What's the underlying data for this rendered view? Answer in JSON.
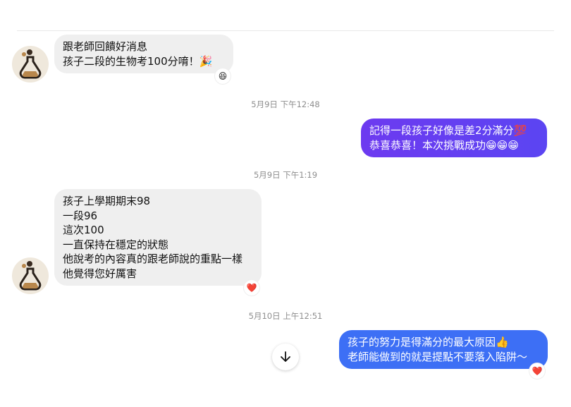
{
  "messages": {
    "m1": {
      "lines": "跟老師回饋好消息\n孩子二段的生物考100分唷！🎉",
      "reaction": "😆"
    },
    "ts1": "5月9日 下午12:48",
    "m2": {
      "lines": "記得一段孩子好像是差2分滿分💯\n恭喜恭喜！本次挑戰成功😁😁😁"
    },
    "ts2": "5月9日 下午1:19",
    "m3": {
      "lines": "孩子上學期期末98\n一段96\n這次100\n一直保持在穩定的狀態\n他說考的內容真的跟老師說的重點一樣\n他覺得您好厲害",
      "reaction": "❤️"
    },
    "ts3": "5月10日 上午12:51",
    "m4": {
      "lines": "孩子的努力是得滿分的最大原因👍\n老師能做到的就是提點不要落入陷阱～",
      "reaction": "❤️"
    }
  },
  "icons": {
    "avatar": "flask-avatar-icon",
    "scroll": "arrow-down-icon"
  },
  "colors": {
    "incoming_bubble": "#efefef",
    "outgoing_purple": "#6a3cf0",
    "outgoing_blue": "#3b6ff5",
    "timestamp": "#8e8e8e"
  }
}
